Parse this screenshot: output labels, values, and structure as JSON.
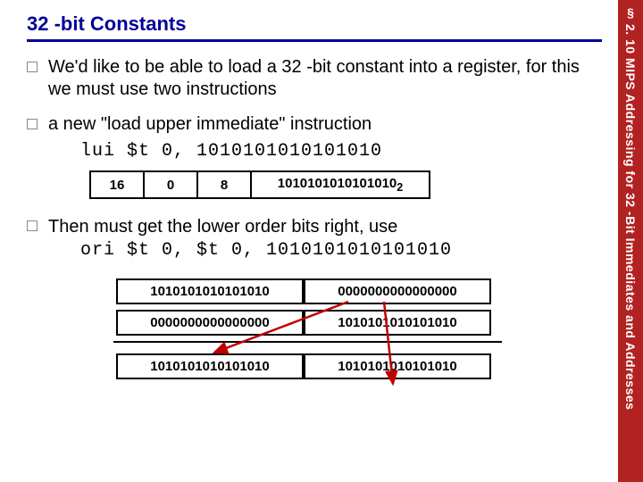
{
  "vertical_label": "§ 2. 10 MIPS Addressing for 32 -Bit Immediates and Addresses",
  "title": "32 -bit Constants",
  "bullets": {
    "b1": "We'd like to be able to load a 32 -bit constant into a register, for this we must use two instructions",
    "b2": "a new \"load upper immediate\" instruction",
    "b3": "Then must get the lower order bits right, use"
  },
  "code": {
    "lui": "lui $t 0, 1010101010101010",
    "ori": "ori $t 0, $t 0, 1010101010101010"
  },
  "instr_fields": {
    "f1": "16",
    "f2": "0",
    "f3": "8",
    "f4": "1010101010101010",
    "f4_sub": "2"
  },
  "bits": {
    "r1c1": "1010101010101010",
    "r1c2": "0000000000000000",
    "r2c1": "0000000000000000",
    "r2c2": "1010101010101010",
    "r3c1": "1010101010101010",
    "r3c2": "1010101010101010"
  },
  "colors": {
    "title": "#000099",
    "sidebar": "#b22222",
    "arrow": "#c00000"
  }
}
